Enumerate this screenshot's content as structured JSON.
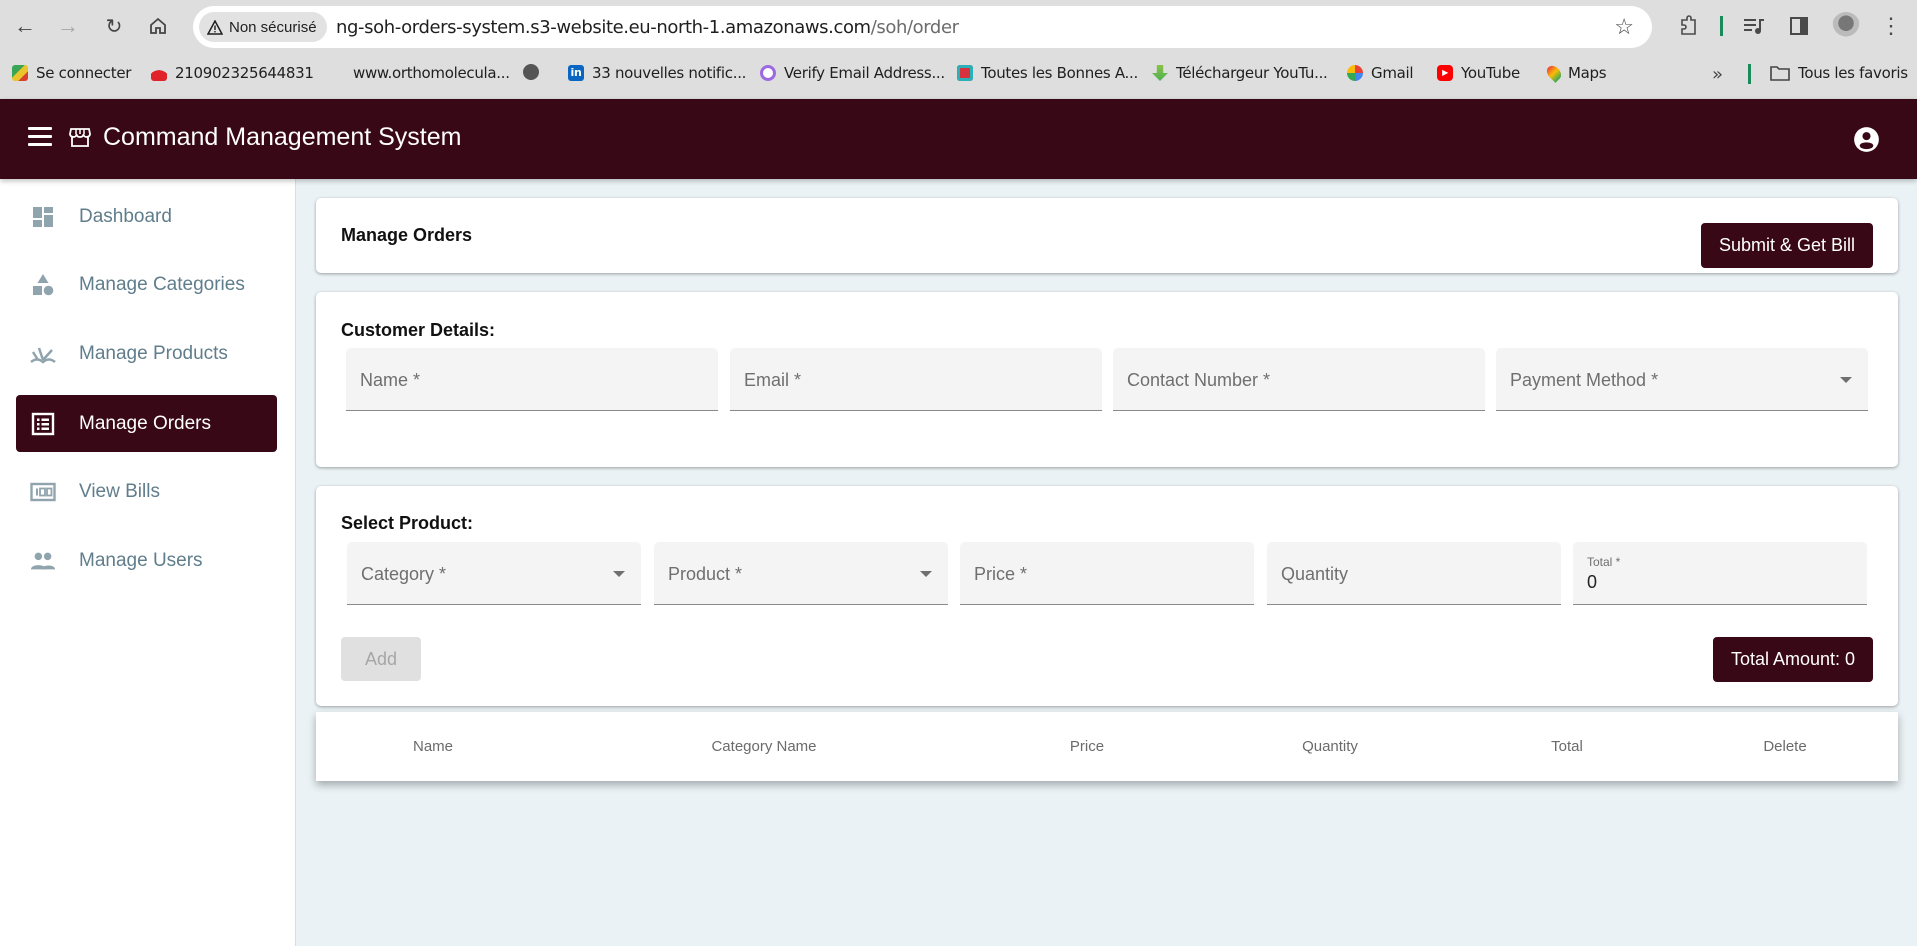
{
  "browser": {
    "security_label": "Non sécurisé",
    "url_host": "ng-soh-orders-system.s3-website.eu-north-1.amazonaws.com",
    "url_path": "/soh/order",
    "bookmarks": [
      {
        "label": "Se connecter",
        "icon": "colorful-logo-icon"
      },
      {
        "label": "210902325644831",
        "icon": "huawei-icon"
      },
      {
        "label": "www.orthomolecula...",
        "icon": ""
      },
      {
        "label": "",
        "icon": "globe-icon"
      },
      {
        "label": "33 nouvelles notific...",
        "icon": "linkedin-icon"
      },
      {
        "label": "Verify Email Address...",
        "icon": "verify-icon"
      },
      {
        "label": "Toutes les Bonnes A...",
        "icon": "bookmark-red-icon"
      },
      {
        "label": "Téléchargeur YouTu...",
        "icon": "download-arrow-icon"
      },
      {
        "label": "Gmail",
        "icon": "google-icon"
      },
      {
        "label": "YouTube",
        "icon": "youtube-icon"
      },
      {
        "label": "Maps",
        "icon": "maps-pin-icon"
      }
    ],
    "overflow_label": "»",
    "all_bookmarks_label": "Tous les favoris"
  },
  "header": {
    "title": "Command Management System"
  },
  "sidebar": {
    "items": [
      {
        "label": "Dashboard",
        "icon": "dashboard-icon",
        "active": false
      },
      {
        "label": "Manage Categories",
        "icon": "category-icon",
        "active": false
      },
      {
        "label": "Manage Products",
        "icon": "products-icon",
        "active": false
      },
      {
        "label": "Manage Orders",
        "icon": "list-alt-icon",
        "active": true
      },
      {
        "label": "View Bills",
        "icon": "bills-icon",
        "active": false
      },
      {
        "label": "Manage Users",
        "icon": "people-icon",
        "active": false
      }
    ]
  },
  "page": {
    "title": "Manage Orders",
    "submit_button": "Submit & Get Bill"
  },
  "customer": {
    "section_title": "Customer Details:",
    "fields": {
      "name": "Name *",
      "email": "Email *",
      "contact": "Contact Number *",
      "payment": "Payment Method *"
    }
  },
  "product": {
    "section_title": "Select Product:",
    "fields": {
      "category": "Category *",
      "product": "Product *",
      "price": "Price *",
      "quantity": "Quantity",
      "total_label": "Total *",
      "total_value": "0"
    },
    "add_button": "Add",
    "total_amount": "Total Amount: 0"
  },
  "table": {
    "columns": [
      "Name",
      "Category Name",
      "Price",
      "Quantity",
      "Total",
      "Delete"
    ],
    "rows": []
  },
  "colors": {
    "primary": "#380817",
    "content_bg": "#eaf2f5",
    "sidebar_text": "#607d8b"
  }
}
